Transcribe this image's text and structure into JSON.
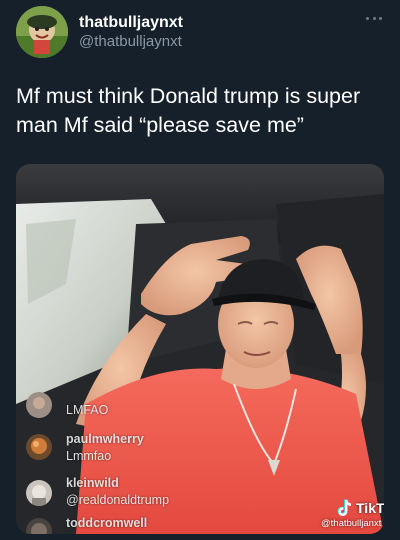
{
  "tweet": {
    "display_name": "thatbulljaynxt",
    "handle": "@thatbulljaynxt",
    "more_icon": "more-horizontal-icon",
    "text": "Mf must think Donald trump is super man Mf said “please save me”"
  },
  "video": {
    "comments": [
      {
        "user": "",
        "text": "LMFAO"
      },
      {
        "user": "paulmwherry",
        "text": "Lmmfao"
      },
      {
        "user": "kleinwild",
        "text": "@realdonaldtrump"
      },
      {
        "user": "toddcromwell",
        "text": ""
      }
    ],
    "watermark": {
      "logo": "TikTok",
      "handle": "@thatbulljanxt"
    }
  },
  "colors": {
    "background": "#15202b",
    "text_primary": "#ffffff",
    "text_secondary": "#8b98a5",
    "shirt": "#f05a4f"
  }
}
